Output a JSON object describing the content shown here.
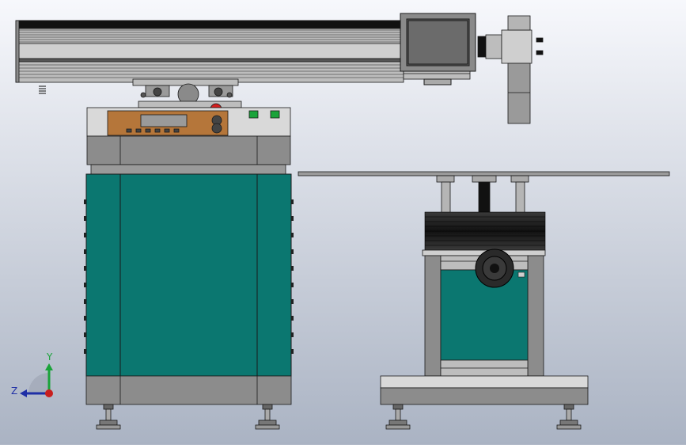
{
  "viewport": {
    "background_top": "#f7f8fc",
    "background_bottom": "#aab3c3"
  },
  "colors": {
    "panel_teal": "#0b7770",
    "frame_gray": "#8c8c8c",
    "light_gray": "#cfcfcf",
    "control_orange": "#b5763a",
    "button_green": "#1aa33a",
    "estop_red": "#d42020",
    "outline": "#1a1a1a"
  },
  "triad": {
    "y_label": "Y",
    "z_label": "Z",
    "y_color": "#1aa33a",
    "z_color": "#1f2fa6",
    "x_color": "#c81e1e"
  }
}
